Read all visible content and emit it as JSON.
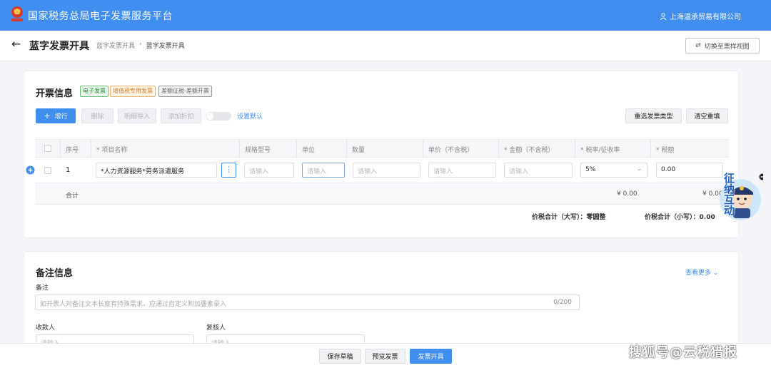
{
  "app": {
    "title": "国家税务总局电子发票服务平台",
    "user": "上海温承贸易有限公司"
  },
  "header": {
    "page_title": "蓝字发票开具",
    "breadcrumb": [
      "蓝字发票开具",
      "蓝字发票开具"
    ],
    "switch_label": "切换至票样视图"
  },
  "invoice": {
    "section_title": "开票信息",
    "tags": [
      "电子发票",
      "增值税专用发票",
      "差额征税-差额开票"
    ],
    "toolbar": {
      "add": "增行",
      "delete": "删除",
      "import": "明细导入",
      "discount": "添加折扣",
      "default": "设置默认",
      "reselect": "重选发票类型",
      "clear": "清空重填"
    },
    "columns": [
      "序号",
      "* 项目名称",
      "规格型号",
      "单位",
      "数量",
      "单价（不含税）",
      "* 金额（不含税）",
      "* 税率/征收率",
      "* 税额"
    ],
    "row": {
      "index": "1",
      "item_name": "*人力资源服务*劳务派遣服务",
      "placeholder": "请输入",
      "tax_rate": "5%",
      "tax": "0.00"
    },
    "total_label": "合计",
    "total_amount": "¥ 0.00",
    "total_tax": "¥ 0.00",
    "upper_label": "价税合计（大写）：",
    "upper_value": "零圆整",
    "lower_label": "价税合计（小写）：",
    "lower_value": "0.00"
  },
  "remark": {
    "section_title": "备注信息",
    "more": "查看更多",
    "label": "备注",
    "placeholder": "如开票人对备注文本长度有特殊需求，应通过自定义附加要素录入",
    "counter": "0/200",
    "payee_label": "收款人",
    "reviewer_label": "复核人",
    "input_placeholder": "请输入"
  },
  "footer": {
    "save": "保存草稿",
    "preview": "预览发票",
    "issue": "发票开具"
  },
  "mascot": {
    "text": "征纳互动"
  },
  "watermark": "搜狐号@云税猎报",
  "colors": {
    "primary": "#3f8ef0",
    "topbar": "#3f8ef0"
  }
}
